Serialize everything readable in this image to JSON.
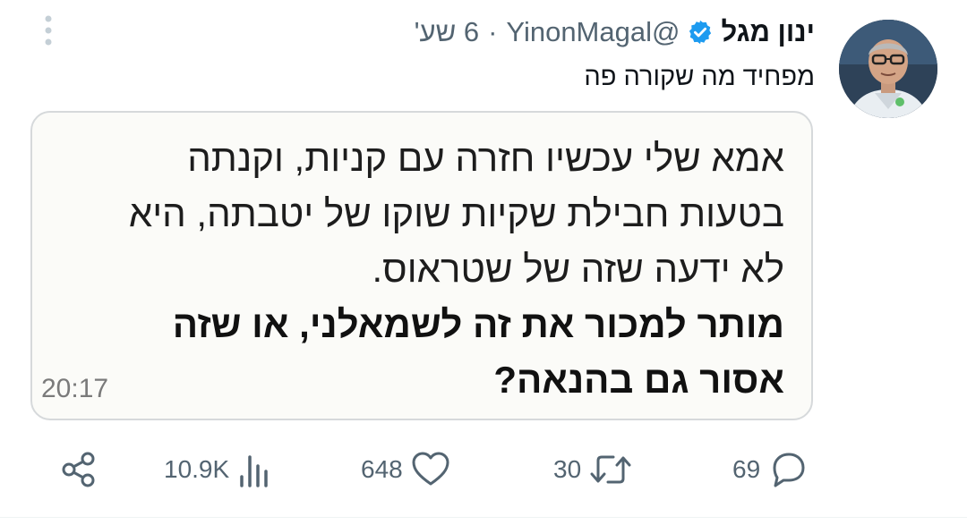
{
  "author": {
    "name": "ינון מגל",
    "handle": "@YinonMagal",
    "separator": "·",
    "time": "6 שע'",
    "verified": true
  },
  "tweet": {
    "text": "מפחיד מה שקורה פה"
  },
  "image": {
    "lines": [
      "אמא שלי עכשיו חזרה עם קניות, וקנתה",
      "בטעות חבילת שקיות שוקו של יטבתה, היא",
      "לא ידעה שזה של שטראוס."
    ],
    "bold_lines": [
      "מותר למכור את זה לשמאלני, או שזה",
      "אסור גם בהנאה?"
    ],
    "timestamp": "20:17"
  },
  "actions": {
    "replies": "69",
    "retweets": "30",
    "likes": "648",
    "views": "10.9K"
  },
  "colors": {
    "verified": "#1d9bf0",
    "muted": "#536471",
    "text": "#0f1419"
  },
  "icons": [
    "more-vertical-icon",
    "verified-badge-icon",
    "reply-icon",
    "retweet-icon",
    "like-icon",
    "views-icon",
    "share-icon"
  ]
}
